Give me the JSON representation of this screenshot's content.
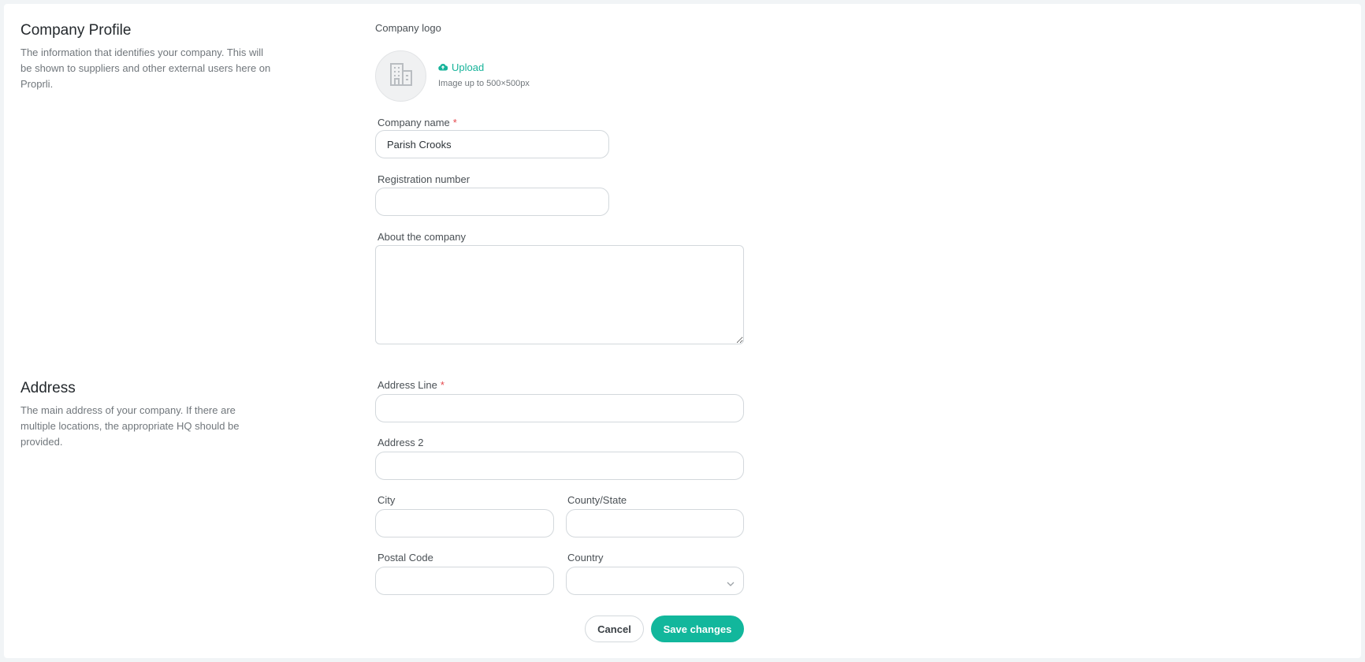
{
  "profile": {
    "title": "Company Profile",
    "description": "The information that identifies your company. This will be shown to suppliers and other external users here on Proprli."
  },
  "logo": {
    "label": "Company logo",
    "upload_label": "Upload",
    "hint": "Image up to 500×500px",
    "icon": "building-icon"
  },
  "fields": {
    "company_name_label": "Company name",
    "company_name_value": "Parish Crooks",
    "registration_label": "Registration number",
    "registration_value": "",
    "about_label": "About the company",
    "about_value": ""
  },
  "address": {
    "title": "Address",
    "description": "The main address of your company. If there are multiple locations, the appropriate HQ should be provided.",
    "line1_label": "Address Line",
    "line1_value": "",
    "line2_label": "Address 2",
    "line2_value": "",
    "city_label": "City",
    "city_value": "",
    "state_label": "County/State",
    "state_value": "",
    "postal_label": "Postal Code",
    "postal_value": "",
    "country_label": "Country",
    "country_value": ""
  },
  "required_mark": "*",
  "actions": {
    "cancel": "Cancel",
    "save": "Save changes"
  },
  "colors": {
    "accent": "#12b79c",
    "required": "#e5484d"
  }
}
